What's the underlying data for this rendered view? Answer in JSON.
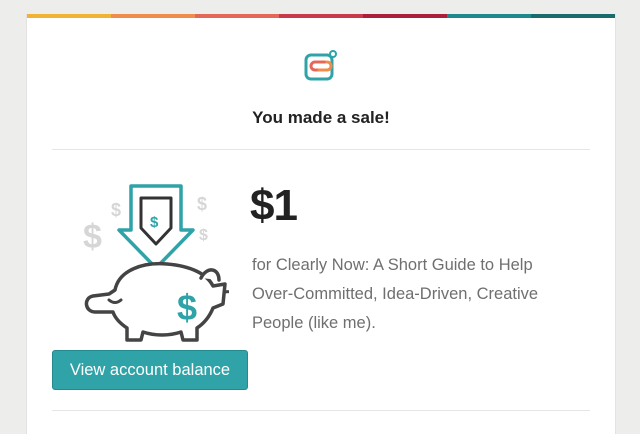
{
  "brand": {
    "stripe_colors": [
      "#f2b233",
      "#f08c4c",
      "#e4685a",
      "#c9394a",
      "#ab1f3a",
      "#1c8a8c",
      "#1a6b6d"
    ],
    "logo_icon": "gumroad-style-link-icon"
  },
  "notification": {
    "heading": "You made a sale!"
  },
  "sale": {
    "amount": "$1",
    "description": "for Clearly Now: A Short Guide to Help Over-Committed, Idea-Driven, Creative People (like me).",
    "illustration_icon": "piggy-bank-deposit-icon"
  },
  "actions": {
    "view_balance_label": "View account balance"
  },
  "colors": {
    "accent": "#2fa3a8",
    "heading": "#222222",
    "body_text": "#6f6f6f",
    "page_bg": "#ededeb"
  }
}
